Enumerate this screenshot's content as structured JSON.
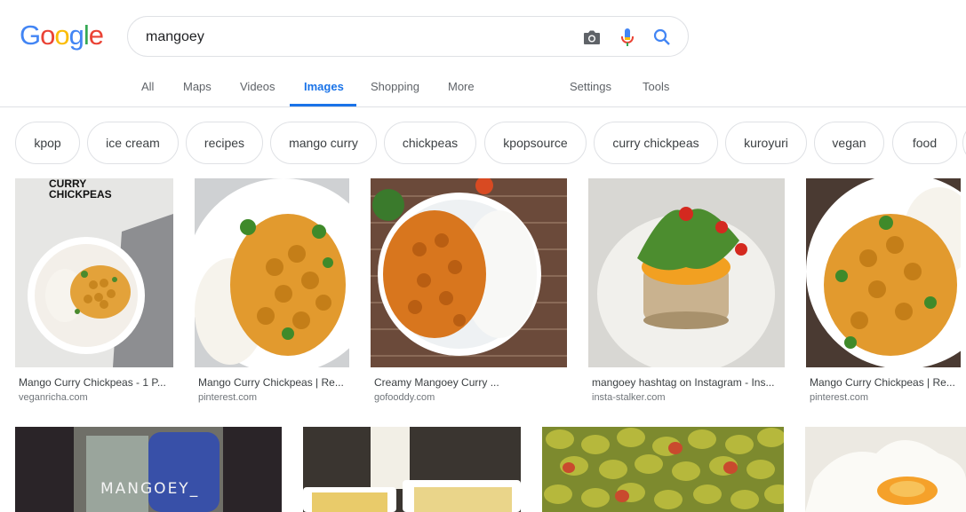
{
  "logo": "Google",
  "search": {
    "value": "mangoey"
  },
  "tabs": [
    {
      "label": "All"
    },
    {
      "label": "Maps"
    },
    {
      "label": "Videos"
    },
    {
      "label": "Images"
    },
    {
      "label": "Shopping"
    },
    {
      "label": "More"
    },
    {
      "label": "Settings"
    },
    {
      "label": "Tools"
    }
  ],
  "active_tab": "Images",
  "chips": [
    {
      "label": "kpop"
    },
    {
      "label": "ice cream"
    },
    {
      "label": "recipes"
    },
    {
      "label": "mango curry"
    },
    {
      "label": "chickpeas"
    },
    {
      "label": "kpopsource"
    },
    {
      "label": "curry chickpeas"
    },
    {
      "label": "kuroyuri"
    },
    {
      "label": "vegan"
    },
    {
      "label": "food"
    }
  ],
  "results": [
    {
      "title": "Mango Curry Chickpeas - 1 P...",
      "source": "veganricha.com",
      "overlay": "CURRY\nCHICKPEAS"
    },
    {
      "title": "Mango Curry Chickpeas | Re...",
      "source": "pinterest.com"
    },
    {
      "title": "Creamy Mangoey Curry ...",
      "source": "gofooddy.com"
    },
    {
      "title": "mangoey hashtag on Instagram - Ins...",
      "source": "insta-stalker.com"
    },
    {
      "title": "Mango Curry Chickpeas | Re...",
      "source": "pinterest.com"
    },
    {
      "overlay": "MANGOEY_"
    },
    {},
    {},
    {}
  ],
  "colors": {
    "accent": "#1a73e8",
    "logo_blue": "#4285f4",
    "logo_red": "#ea4335",
    "logo_yellow": "#fbbc05",
    "logo_green": "#34a853"
  }
}
